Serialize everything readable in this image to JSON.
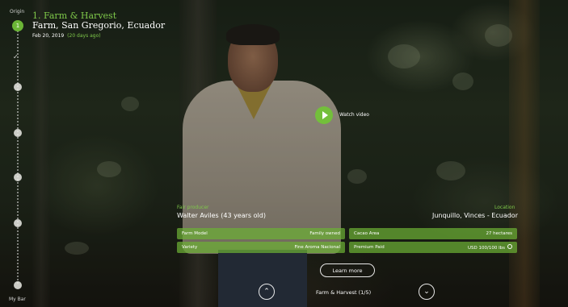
{
  "rail": {
    "top_label": "Origin",
    "bottom_label": "My Bar",
    "active_number": "1",
    "check_glyph": "✓"
  },
  "header": {
    "stage_title": "1. Farm & Harvest",
    "location": "Farm, San Gregorio, Ecuador",
    "date": "Feb 20, 2019",
    "date_ago": "(20 days ago)"
  },
  "video": {
    "play_icon": "play-icon",
    "label": "Watch video"
  },
  "info": {
    "farmer_label": "Fair producer",
    "farmer_value": "Walter Aviles (43 years old)",
    "location_label": "Location",
    "location_value": "Junquillo, Vinces - Ecuador"
  },
  "details": [
    {
      "label": "Farm Model",
      "value": "Family owned"
    },
    {
      "label": "Cacao Area",
      "value": "27 hectares"
    },
    {
      "label": "Variety",
      "value": "Fine Aroma Nacional"
    },
    {
      "label": "Premium Paid",
      "value": "USD 100/100 lbs"
    }
  ],
  "learn_more": "Learn more",
  "nav": {
    "up_glyph": "⌃",
    "down_glyph": "⌄",
    "label": "Farm & Harvest (1/5)"
  },
  "colors": {
    "accent": "#6bb536",
    "cell_bg": "#6cb034"
  }
}
